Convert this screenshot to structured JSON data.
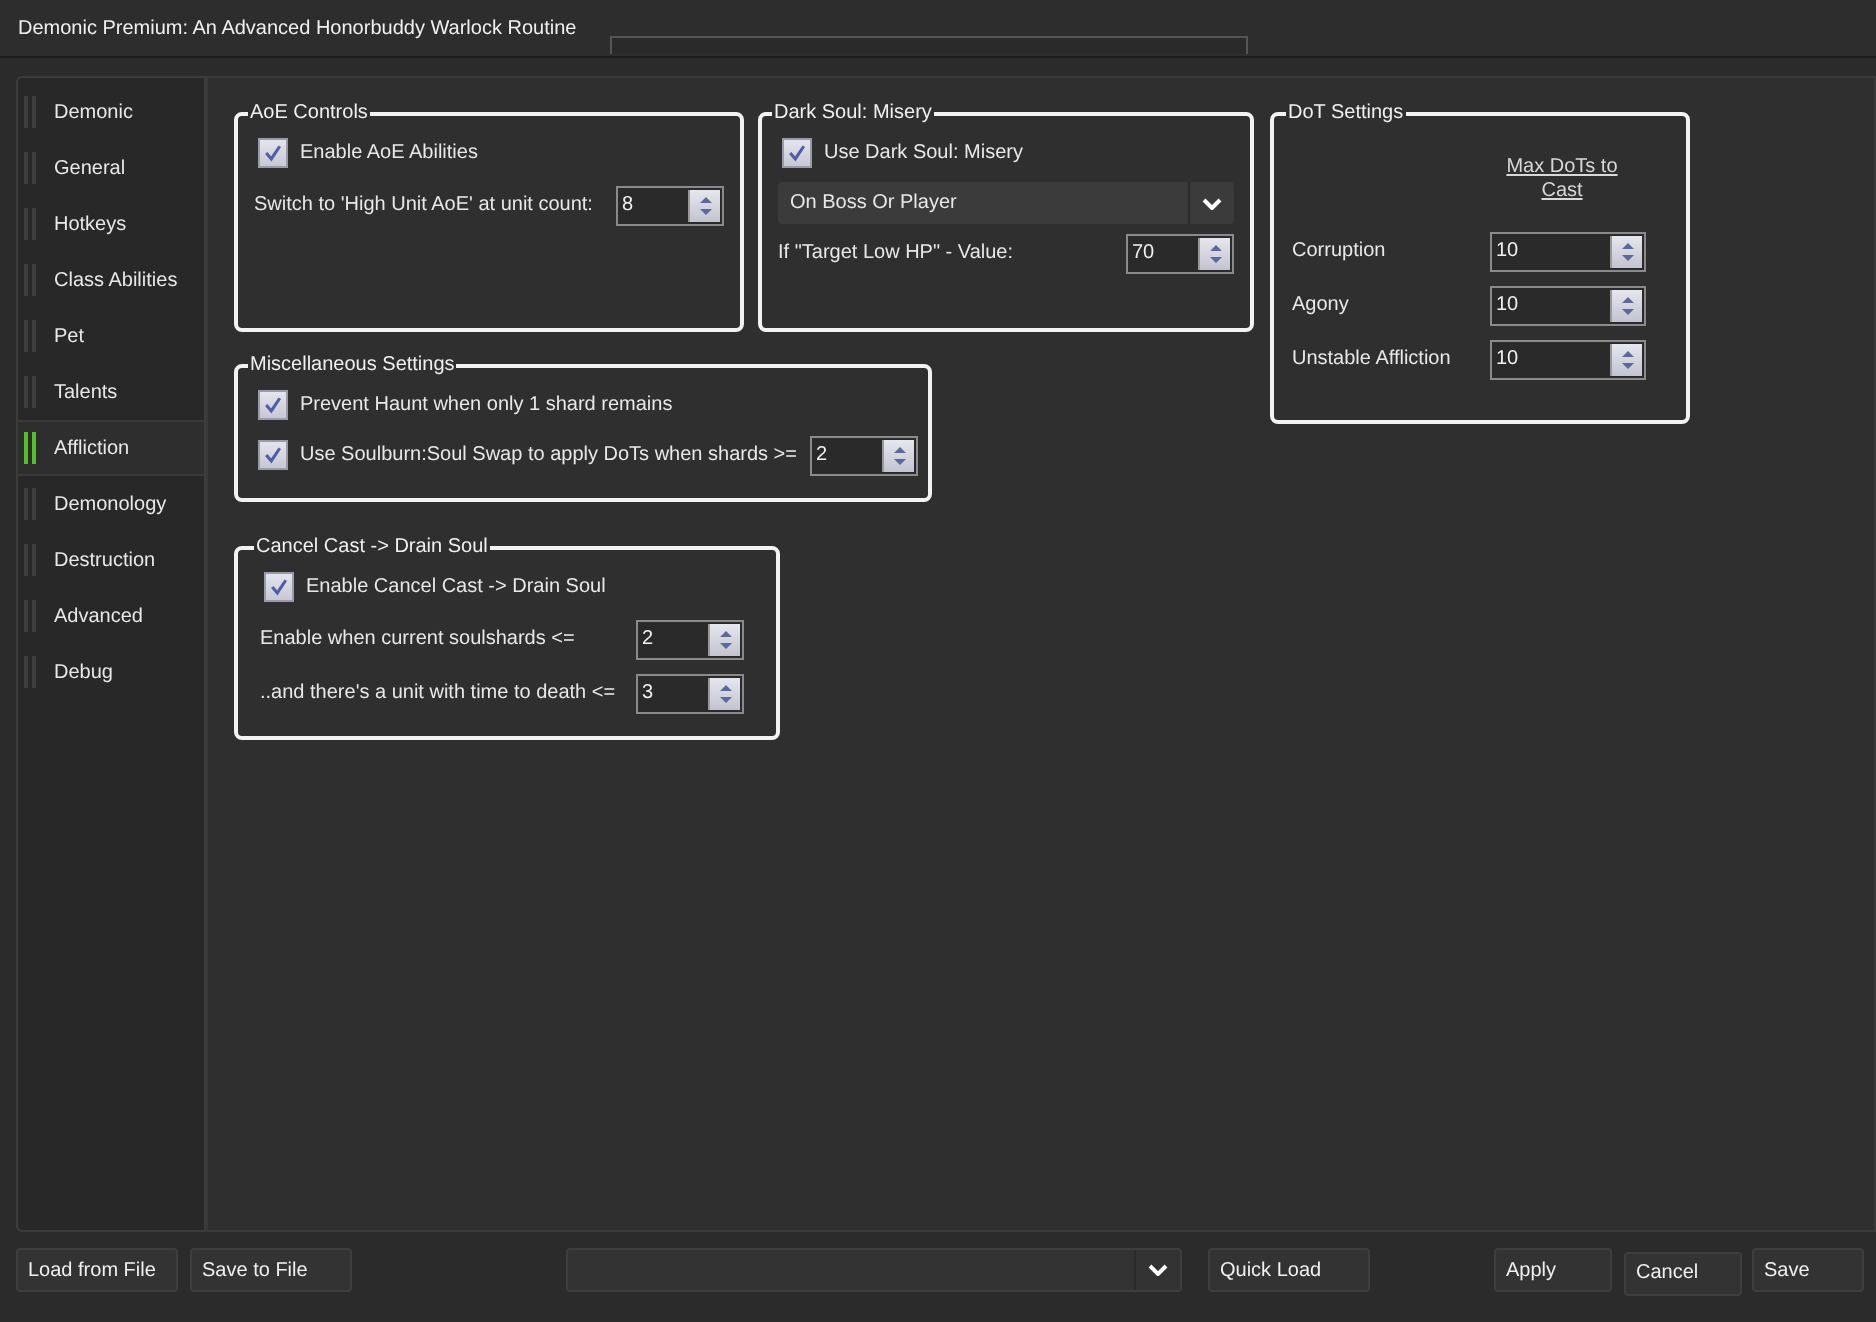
{
  "window": {
    "title": "Demonic Premium: An Advanced Honorbuddy Warlock Routine"
  },
  "sidebar": {
    "items": [
      {
        "label": "Demonic",
        "selected": false
      },
      {
        "label": "General",
        "selected": false
      },
      {
        "label": "Hotkeys",
        "selected": false
      },
      {
        "label": "Class Abilities",
        "selected": false
      },
      {
        "label": "Pet",
        "selected": false
      },
      {
        "label": "Talents",
        "selected": false
      },
      {
        "label": "Affliction",
        "selected": true
      },
      {
        "label": "Demonology",
        "selected": false
      },
      {
        "label": "Destruction",
        "selected": false
      },
      {
        "label": "Advanced",
        "selected": false
      },
      {
        "label": "Debug",
        "selected": false
      }
    ]
  },
  "groups": [
    {
      "title": "AoE Controls",
      "rows": [
        {
          "kind": "checkbox",
          "label": "Enable AoE Abilities",
          "checked": true
        },
        {
          "kind": "spinner",
          "label": "Switch to 'High Unit AoE' at unit count:",
          "value": "8"
        }
      ]
    },
    {
      "title": "Dark Soul: Misery",
      "rows": [
        {
          "kind": "checkbox",
          "label": "Use Dark Soul: Misery",
          "checked": true
        },
        {
          "kind": "dropdown",
          "value": "On Boss Or Player"
        },
        {
          "kind": "spinner",
          "label": "If \"Target Low HP\" - Value:",
          "value": "70"
        }
      ]
    },
    {
      "title": "DoT Settings",
      "rows": [
        {
          "kind": "header",
          "label": "Max DoTs to Cast"
        },
        {
          "kind": "spinner",
          "label": "Corruption",
          "value": "10"
        },
        {
          "kind": "spinner",
          "label": "Agony",
          "value": "10"
        },
        {
          "kind": "spinner",
          "label": "Unstable Affliction",
          "value": "10"
        }
      ]
    },
    {
      "title": "Miscellaneous Settings",
      "rows": [
        {
          "kind": "checkbox",
          "label": "Prevent Haunt when only 1 shard remains",
          "checked": true
        },
        {
          "kind": "checkbox-spinner",
          "label": "Use Soulburn:Soul Swap to apply DoTs when shards >=",
          "checked": true,
          "value": "2"
        }
      ]
    },
    {
      "title": "Cancel Cast -> Drain Soul",
      "rows": [
        {
          "kind": "checkbox",
          "label": "Enable Cancel Cast -> Drain Soul",
          "checked": true
        },
        {
          "kind": "spinner",
          "label": "Enable when current soulshards <=",
          "value": "2"
        },
        {
          "kind": "spinner",
          "label": "..and there's a unit with time to death <=",
          "value": "3"
        }
      ]
    }
  ],
  "footer": {
    "items": [
      {
        "kind": "button",
        "label": "Load from File"
      },
      {
        "kind": "button",
        "label": "Save to File"
      },
      {
        "kind": "dropdown"
      },
      {
        "kind": "button",
        "label": "Quick Load"
      },
      {
        "kind": "button",
        "label": "Apply"
      },
      {
        "kind": "button",
        "label": "Cancel"
      },
      {
        "kind": "button",
        "label": "Save"
      }
    ]
  }
}
